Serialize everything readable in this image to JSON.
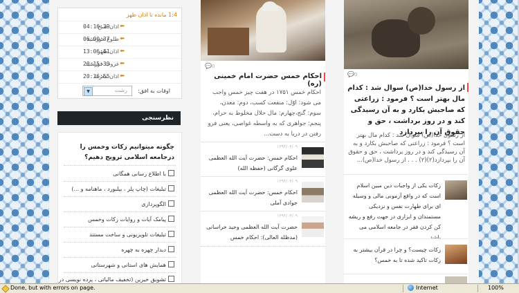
{
  "prayer_times": {
    "remaining_label": "1:4 مانده تا",
    "remaining_target": "اذان ظهر",
    "rows": [
      {
        "name": "اذان صبح",
        "time": "04:16:39"
      },
      {
        "name": "طلوع خورشید",
        "time": "06:00:37"
      },
      {
        "name": "اذان ظهر",
        "time": "13:06:41"
      },
      {
        "name": "غروب خورشید",
        "time": "20:15:39"
      },
      {
        "name": "اذان مغرب",
        "time": "20:36:55"
      }
    ],
    "city_label": "اوقات به افق:",
    "city_value": "رشت"
  },
  "poll": {
    "header": "نظرسنجی",
    "question": "چگونه میتوانیم زکات وخمس را درجامعه اسلامی ترویج دهیم؟",
    "options": [
      "با اطلاع رسانی همگانی",
      "تبلیغات (چاپ پلر ، بیلبورد ، ماهنامه و ...)",
      "الگوپردازی",
      "پیامک آیات و روایات زکات وخمس",
      "تبلیغات تلویزیونی و ساخت مستند",
      "دیدار چهره به چهره",
      "همایش های استانی و شهرستانی",
      "تشویق خیرین (تخفیف مالیاتی ، پرده نویسی در شهر"
    ]
  },
  "middle_column": {
    "comment_count": "0",
    "title": "احکام خمس حضرت امام خمینی (ره)",
    "excerpt": "احکام خمس ۱۷۵۱ در هفت چیز خمس واجب می شود: اوّل: منفعت کسب، دوم: معدن، سوم: گنج،چهارم: مال حلال مخلوط به حرام، پنجم: جواهری که به واسطه غواصی، یعنی فرو رفتن در دریا به دست...",
    "items": [
      {
        "date": "۱۳۹۴/۰۴/۰۹",
        "text": "احکام خمس: حضرت آیت الله العظمی علوی گرگانی (حفظه الله)"
      },
      {
        "date": "۱۳۹۴/۰۴/۰۹",
        "text": "احکام خمس: حضرت آیت الله العظمی جوادی آملی"
      },
      {
        "date": "۱۳۹۴/۰۴/۰۹",
        "text": "حضرت آیت الله العظمی وحید خراسانی (مدظله العالی): احکام خمس"
      }
    ]
  },
  "right_column": {
    "comment_count": "0",
    "title": "از رسول خدا(ص) سوال شد : کدام مال بهتر است ؟ فرمود : زراعتی که صاحبش بکارد و به آن رسیدگی کند و در روز برداشت ، حق و حقوق آن را بپردازد",
    "excerpt": "از رسول خدا(ص) سوال شد : کدام مال بهتر است ؟ فرمود : زراعتی که صاحبش بکارد و به آن رسیدگی کند و در روز برداشت ، حق و حقوق آن را بپردازد(۲)(۲) . . . از رسول خدا(ص)...",
    "items": [
      {
        "text": "زکات یکی از واجبات دین مبین اسلام است که در واقع آزمونی مالی و وسیله ای برای طهارت نفس و نزدیکی مستمندان و ابزاری در جهت رفع و ریشه کن کردن فقر در جامعه اسلامی می باشد"
      },
      {
        "text": "زکات چیست؟ و چرا در قرآن بیشتر به زکات تاکید شده تا به خمس؟"
      }
    ]
  },
  "statusbar": {
    "text": "Done, but with errors on page.",
    "zone": "Internet",
    "zoom": "100%"
  }
}
